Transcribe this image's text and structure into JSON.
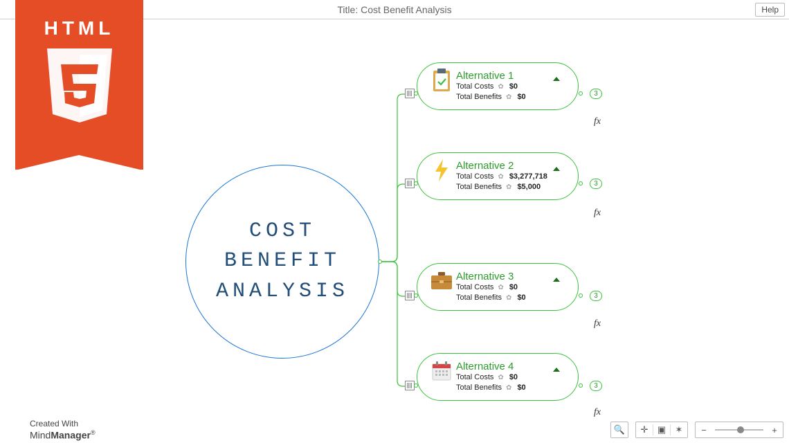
{
  "header": {
    "title": "Title: Cost Benefit Analysis",
    "help": "Help"
  },
  "badge": {
    "text": "HTML"
  },
  "central": {
    "lines": "COST\nBENEFIT\nANALYSIS"
  },
  "labels": {
    "fx": "fx",
    "gear": "✿"
  },
  "row_labels": {
    "costs": "Total Costs",
    "benefits": "Total Benefits"
  },
  "alts": [
    {
      "title": "Alternative 1",
      "costs": "$0",
      "benefits": "$0",
      "count": "3"
    },
    {
      "title": "Alternative 2",
      "costs": "$3,277,718",
      "benefits": "$5,000",
      "count": "3"
    },
    {
      "title": "Alternative 3",
      "costs": "$0",
      "benefits": "$0",
      "count": "3"
    },
    {
      "title": "Alternative 4",
      "costs": "$0",
      "benefits": "$0",
      "count": "3"
    }
  ],
  "footer": {
    "created": "Created With",
    "brand_a": "Mind",
    "brand_b": "Manager",
    "reg": "®"
  },
  "toolbar": {
    "search": "🔍",
    "center": "✛",
    "fit": "▣",
    "focus": "✶",
    "zoom_out": "−",
    "zoom_in": "+"
  }
}
